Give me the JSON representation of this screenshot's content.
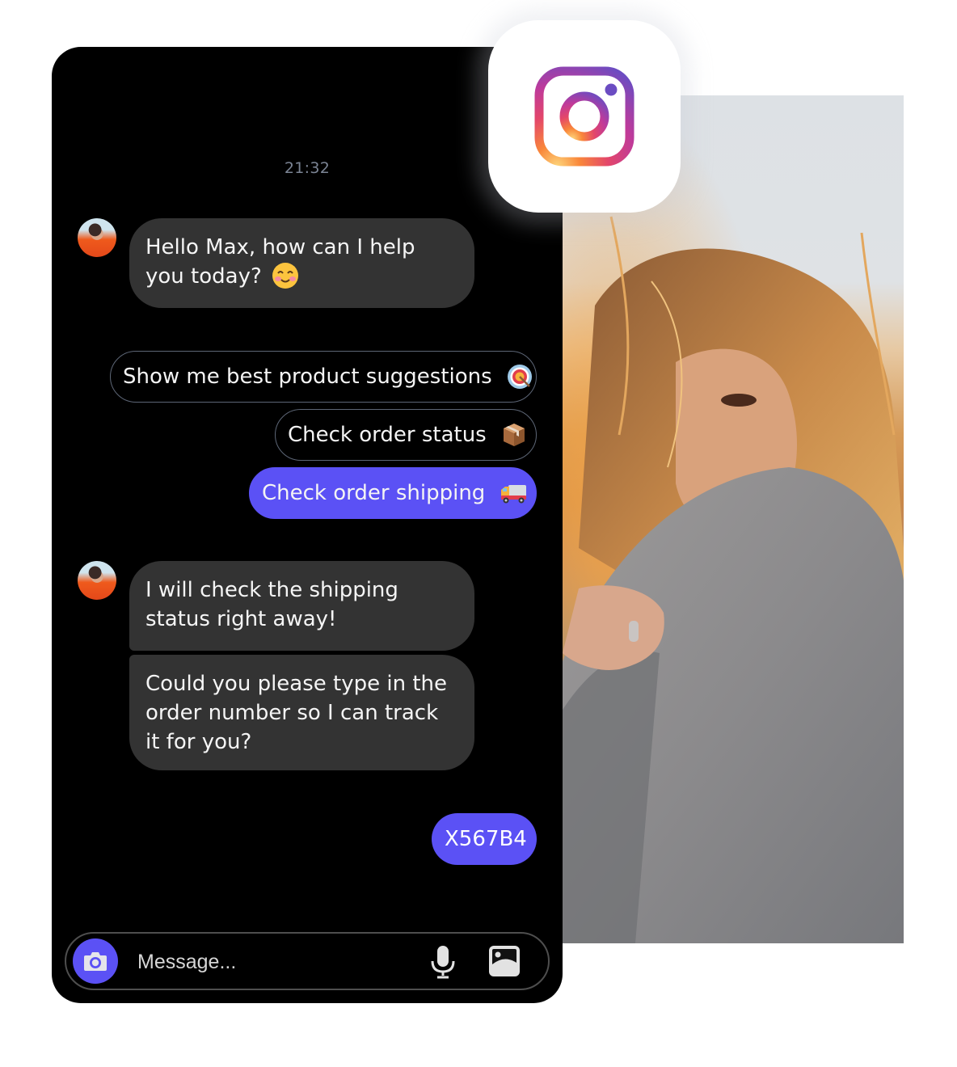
{
  "chat": {
    "timestamp": "21:32",
    "messages": [
      {
        "from": "bot",
        "text": "Hello Max, how can I help you today?",
        "emoji": "☺",
        "emoji_name": "smiling-blush"
      },
      {
        "from": "bot",
        "text": "I will check the shipping status right away!"
      },
      {
        "from": "bot",
        "text": "Could you please type in the order number so I can track it for you?"
      },
      {
        "from": "user",
        "text": "X567B4"
      }
    ],
    "quick_replies": [
      {
        "label": "Show me best product suggestions",
        "icon": "target-icon",
        "active": false
      },
      {
        "label": "Check order status",
        "icon": "package-icon",
        "active": false
      },
      {
        "label": "Check order shipping",
        "icon": "truck-icon",
        "active": true
      }
    ]
  },
  "composer": {
    "placeholder": "Message...",
    "value": "",
    "icons": [
      "camera-icon",
      "microphone-icon",
      "gallery-icon"
    ]
  },
  "brand": {
    "name": "Instagram",
    "logo_icon": "instagram-logo-icon"
  },
  "colors": {
    "panel_bg": "#000000",
    "bot_bubble": "#333333",
    "accent": "#5b51f5",
    "chip_border": "#5d6676",
    "timestamp": "#7b8494"
  },
  "photo": {
    "description": "Woman with windswept blonde hair wrapped in grey knit blanket"
  }
}
